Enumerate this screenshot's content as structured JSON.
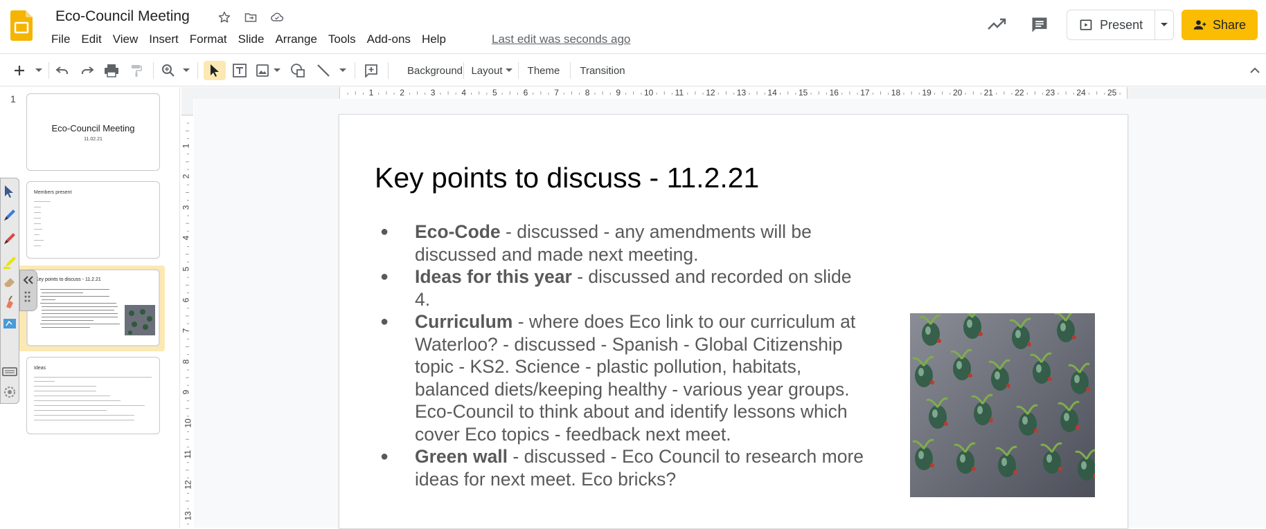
{
  "doc": {
    "title": "Eco-Council Meeting",
    "last_edit": "Last edit was seconds ago"
  },
  "menu": [
    "File",
    "Edit",
    "View",
    "Insert",
    "Format",
    "Slide",
    "Arrange",
    "Tools",
    "Add-ons",
    "Help"
  ],
  "header_buttons": {
    "present": "Present",
    "share": "Share"
  },
  "toolbar": {
    "background": "Background",
    "layout": "Layout",
    "theme": "Theme",
    "transition": "Transition"
  },
  "filmstrip": {
    "slides": [
      {
        "num": "1",
        "title": "Eco-Council Meeting",
        "subtitle": "11.02.21"
      },
      {
        "num": "2",
        "title": "Members present"
      },
      {
        "num": "3",
        "title": "Key points to discuss - 11.2.21"
      },
      {
        "num": "4",
        "title": "Ideas"
      }
    ]
  },
  "ruler": {
    "h": [
      "1",
      "2",
      "3",
      "4",
      "5",
      "6",
      "7",
      "8",
      "9",
      "10",
      "11",
      "12",
      "13",
      "14",
      "15",
      "16",
      "17",
      "18",
      "19",
      "20",
      "21",
      "22",
      "23",
      "24",
      "25"
    ],
    "v": [
      "1",
      "2",
      "3",
      "4",
      "5",
      "6",
      "7",
      "8",
      "9",
      "10",
      "11",
      "12",
      "13"
    ]
  },
  "slide": {
    "title": "Key points to discuss - 11.2.21",
    "bullets": [
      {
        "bold": "Eco-Code",
        "text": " - discussed - any amendments will be discussed and made next meeting."
      },
      {
        "bold": "Ideas for this year",
        "text": " - discussed and recorded on slide 4."
      },
      {
        "bold": "Curriculum",
        "text": " - where does Eco link to our curriculum at Waterloo? - discussed - Spanish - Global Citizenship topic - KS2. Science - plastic pollution, habitats, balanced diets/keeping healthy - various year groups. Eco-Council to think about and identify lessons which cover Eco topics - feedback next meet."
      },
      {
        "bold": "Green wall",
        "text": " - discussed - Eco Council to research more ideas for next meet. Eco bricks?"
      }
    ]
  },
  "colors": {
    "accent": "#fbbc04",
    "slides_logo": "#f4b400",
    "selected_thumb_bg": "#fce8b2",
    "body_text": "#595959"
  }
}
